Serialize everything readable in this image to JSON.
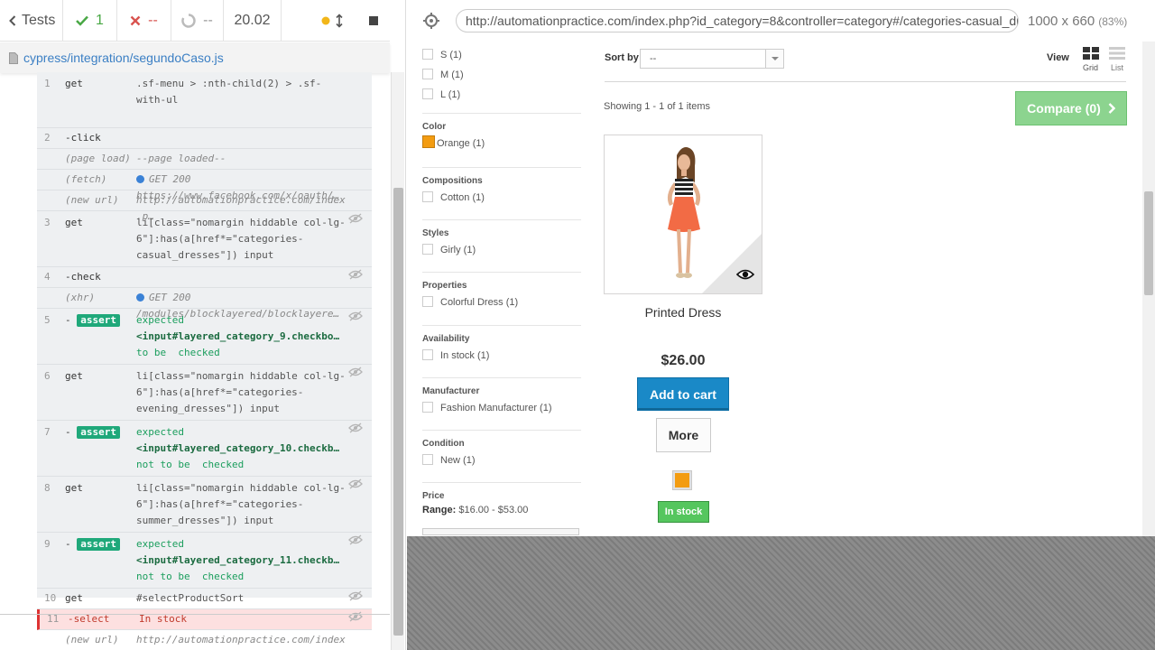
{
  "reporter": {
    "tests_label": "Tests",
    "passed": "1",
    "failed": "--",
    "pending": "--",
    "duration": "20.02",
    "spec_path": "cypress/integration/segundoCaso.js"
  },
  "commands": [
    {
      "num": "1",
      "name": "get",
      "msg": ".sf-menu > :nth-child(2) > .sf-with-ul",
      "type": "normal",
      "eye": false
    },
    {
      "num": "2",
      "name": "-click",
      "msg": "",
      "type": "normal",
      "eye": false
    },
    {
      "num": "",
      "name": "(page load)",
      "msg": "--page loaded--",
      "type": "event",
      "eye": false
    },
    {
      "num": "",
      "name": "(fetch)",
      "msg": "GET 200 https://www.facebook.com/x/oauth/…",
      "type": "event-dot",
      "eye": false
    },
    {
      "num": "",
      "name": "(new url)",
      "msg": "http://automationpractice.com/index.p…",
      "type": "event",
      "eye": false
    },
    {
      "num": "3",
      "name": "get",
      "msg": "li[class=\"nomargin hiddable col-lg-6\"]:has(a[href*=\"categories-casual_dresses\"]) input",
      "type": "normal",
      "eye": true
    },
    {
      "num": "4",
      "name": "-check",
      "msg": "",
      "type": "normal",
      "eye": true
    },
    {
      "num": "",
      "name": "(xhr)",
      "msg": "GET 200 /modules/blocklayered/blocklayere…",
      "type": "event-dot",
      "eye": false
    },
    {
      "num": "5",
      "name": "assert",
      "msg_lines": [
        "expected",
        "<input#layered_category_9.checkbo…",
        "to be  checked"
      ],
      "type": "assert",
      "eye": true
    },
    {
      "num": "6",
      "name": "get",
      "msg": "li[class=\"nomargin hiddable col-lg-6\"]:has(a[href*=\"categories-evening_dresses\"]) input",
      "type": "normal",
      "eye": true
    },
    {
      "num": "7",
      "name": "assert",
      "msg_lines": [
        "expected",
        "<input#layered_category_10.checkb…",
        "not to be  checked"
      ],
      "type": "assert",
      "eye": true
    },
    {
      "num": "8",
      "name": "get",
      "msg": "li[class=\"nomargin hiddable col-lg-6\"]:has(a[href*=\"categories-summer_dresses\"]) input",
      "type": "normal",
      "eye": true
    },
    {
      "num": "9",
      "name": "assert",
      "msg_lines": [
        "expected",
        "<input#layered_category_11.checkb…",
        "not to be  checked"
      ],
      "type": "assert",
      "eye": true
    },
    {
      "num": "10",
      "name": "get",
      "msg": "#selectProductSort",
      "type": "normal",
      "eye": true
    },
    {
      "num": "11",
      "name": "-select",
      "msg": "In stock",
      "type": "error",
      "eye": true
    },
    {
      "num": "",
      "name": "(new url)",
      "msg": "http://automationpractice.com/index.p…",
      "type": "event",
      "eye": false
    }
  ],
  "runner": {
    "url": "http://automationpractice.com/index.php?id_category=8&controller=category#/categories-casual_dresses",
    "viewport": "1000 x 660",
    "zoom": "(83%)"
  },
  "filters": {
    "sizes": [
      "S (1)",
      "M (1)",
      "L (1)"
    ],
    "color": {
      "title": "Color",
      "item": "Orange (1)",
      "swatch": "#f39c11"
    },
    "groups": [
      {
        "title": "Compositions",
        "item": "Cotton (1)"
      },
      {
        "title": "Styles",
        "item": "Girly (1)"
      },
      {
        "title": "Properties",
        "item": "Colorful Dress (1)"
      },
      {
        "title": "Availability",
        "item": "In stock (1)"
      },
      {
        "title": "Manufacturer",
        "item": "Fashion Manufacturer (1)"
      },
      {
        "title": "Condition",
        "item": "New (1)"
      }
    ],
    "price": {
      "title": "Price",
      "range_label": "Range:",
      "range_value": "$16.00 - $53.00"
    }
  },
  "catalog": {
    "sort_label": "Sort by",
    "sort_value": "--",
    "view_label": "View",
    "grid_label": "Grid",
    "list_label": "List",
    "showing": "Showing 1 - 1 of 1 items",
    "compare": "Compare (0)"
  },
  "product": {
    "name": "Printed Dress",
    "price": "$26.00",
    "add_to_cart": "Add to cart",
    "more": "More",
    "stock": "In stock",
    "color": "#f39c11"
  }
}
